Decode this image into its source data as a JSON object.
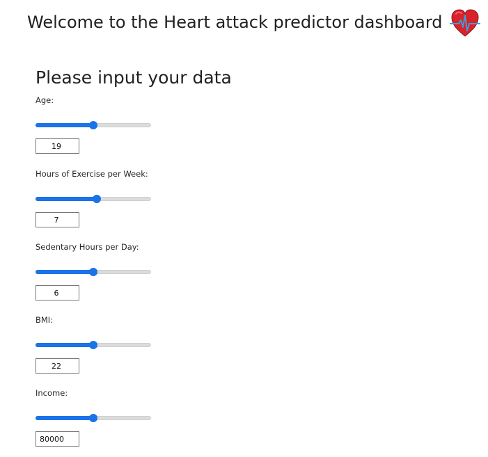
{
  "header": {
    "title": "Welcome to the Heart attack predictor dashboard",
    "logo_icon": "heart-ecg-icon"
  },
  "form": {
    "title": "Please input your data",
    "fields": [
      {
        "label": "Age:",
        "value": "19",
        "slider_fraction": 0.5
      },
      {
        "label": "Hours of Exercise per Week:",
        "value": "7",
        "slider_fraction": 0.53
      },
      {
        "label": "Sedentary Hours per Day:",
        "value": "6",
        "slider_fraction": 0.5
      },
      {
        "label": "BMI:",
        "value": "22",
        "slider_fraction": 0.5
      },
      {
        "label": "Income:",
        "value": "80000",
        "slider_fraction": 0.5
      }
    ]
  },
  "colors": {
    "accent": "#1a73e8",
    "track": "#dcdcdc",
    "heart": "#d9232a",
    "ecg_line": "#3aa0d8"
  }
}
